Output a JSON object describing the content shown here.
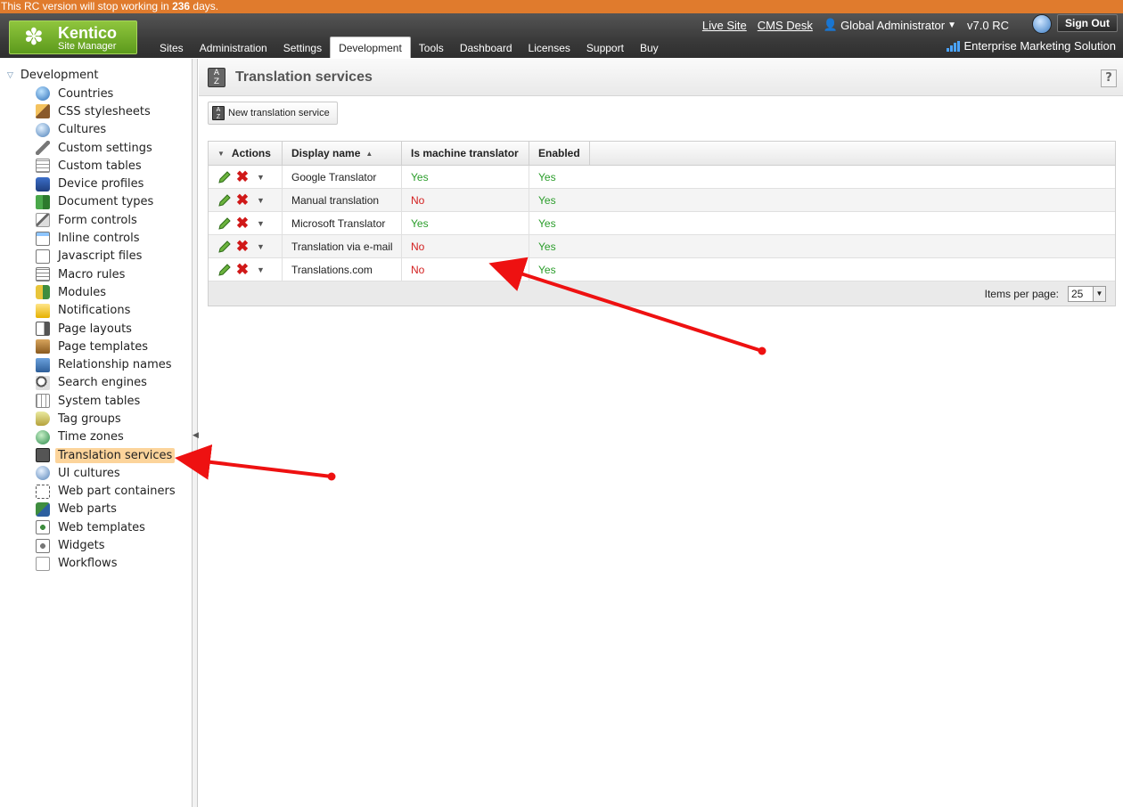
{
  "banner": {
    "prefix": "This RC version will stop working in ",
    "days": "236",
    "suffix": " days."
  },
  "logo": {
    "brand": "Kentico",
    "subtitle": "Site Manager"
  },
  "nav": {
    "tabs": [
      "Sites",
      "Administration",
      "Settings",
      "Development",
      "Tools",
      "Dashboard",
      "Licenses",
      "Support",
      "Buy"
    ],
    "active": "Development"
  },
  "toplinks": {
    "live_site": "Live Site",
    "cms_desk": "CMS Desk",
    "user": "Global Administrator",
    "version": "v7.0 RC",
    "sign_out": "Sign Out",
    "edition": "Enterprise Marketing Solution"
  },
  "tree": {
    "root": "Development",
    "items": [
      {
        "label": "Countries",
        "icon": "globe-icon"
      },
      {
        "label": "CSS stylesheets",
        "icon": "brush-icon"
      },
      {
        "label": "Cultures",
        "icon": "world-icon"
      },
      {
        "label": "Custom settings",
        "icon": "wrench-icon"
      },
      {
        "label": "Custom tables",
        "icon": "table-icon"
      },
      {
        "label": "Device profiles",
        "icon": "device-icon"
      },
      {
        "label": "Document types",
        "icon": "document-types-icon"
      },
      {
        "label": "Form controls",
        "icon": "form-controls-icon"
      },
      {
        "label": "Inline controls",
        "icon": "inline-controls-icon"
      },
      {
        "label": "Javascript files",
        "icon": "js-file-icon"
      },
      {
        "label": "Macro rules",
        "icon": "macro-rules-icon"
      },
      {
        "label": "Modules",
        "icon": "modules-icon"
      },
      {
        "label": "Notifications",
        "icon": "notification-icon"
      },
      {
        "label": "Page layouts",
        "icon": "page-layout-icon"
      },
      {
        "label": "Page templates",
        "icon": "page-template-icon"
      },
      {
        "label": "Relationship names",
        "icon": "relationship-icon"
      },
      {
        "label": "Search engines",
        "icon": "search-engine-icon"
      },
      {
        "label": "System tables",
        "icon": "system-table-icon"
      },
      {
        "label": "Tag groups",
        "icon": "tag-icon"
      },
      {
        "label": "Time zones",
        "icon": "time-zone-icon"
      },
      {
        "label": "Translation services",
        "icon": "translation-icon",
        "selected": true
      },
      {
        "label": "UI cultures",
        "icon": "ui-culture-icon"
      },
      {
        "label": "Web part containers",
        "icon": "container-icon"
      },
      {
        "label": "Web parts",
        "icon": "web-parts-icon"
      },
      {
        "label": "Web templates",
        "icon": "web-template-icon"
      },
      {
        "label": "Widgets",
        "icon": "widget-icon"
      },
      {
        "label": "Workflows",
        "icon": "workflow-icon"
      }
    ]
  },
  "page": {
    "title": "Translation services",
    "help": "?",
    "new_button": "New translation service"
  },
  "grid": {
    "columns": [
      "Actions",
      "Display name",
      "Is machine translator",
      "Enabled"
    ],
    "rows": [
      {
        "name": "Google Translator",
        "machine": "Yes",
        "enabled": "Yes"
      },
      {
        "name": "Manual translation",
        "machine": "No",
        "enabled": "Yes"
      },
      {
        "name": "Microsoft Translator",
        "machine": "Yes",
        "enabled": "Yes"
      },
      {
        "name": "Translation via e-mail",
        "machine": "No",
        "enabled": "Yes"
      },
      {
        "name": "Translations.com",
        "machine": "No",
        "enabled": "Yes"
      }
    ],
    "items_per_page_label": "Items per page:",
    "items_per_page": "25"
  },
  "colors": {
    "annotation_arrow": "#ee1111",
    "selected_item": "#fcd49b",
    "yes": "#2a9d2a",
    "no": "#d32020"
  }
}
